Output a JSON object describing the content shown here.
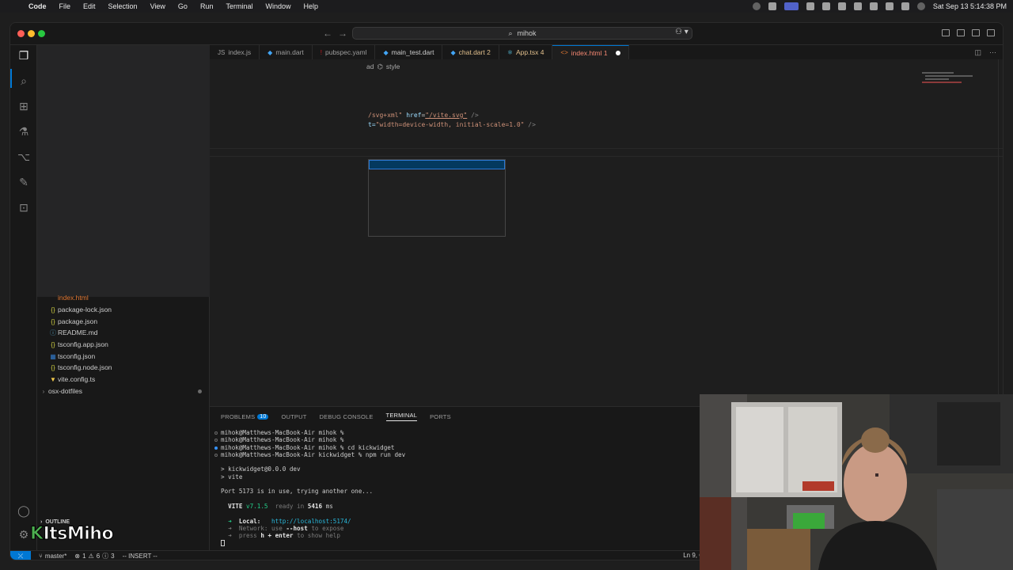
{
  "menubar": {
    "app": "Code",
    "items": [
      "File",
      "Edit",
      "Selection",
      "View",
      "Go",
      "Run",
      "Terminal",
      "Window",
      "Help"
    ],
    "clock": "Sat Sep 13  5:14:38 PM"
  },
  "titlebar": {
    "search": "mihok"
  },
  "tabs": [
    {
      "label": "index.js",
      "icon": "js-icon"
    },
    {
      "label": "main.dart",
      "icon": "dart-icon"
    },
    {
      "label": "pubspec.yaml",
      "icon": "yaml-icon"
    },
    {
      "label": "main_test.dart",
      "icon": "dart-icon"
    },
    {
      "label": "chat.dart 2",
      "icon": "dart-icon"
    },
    {
      "label": "App.tsx 4",
      "icon": "react-icon"
    },
    {
      "label": "index.html 1",
      "icon": "html-icon"
    }
  ],
  "editor": {
    "breadcrumb": [
      "ad",
      "style"
    ],
    "line1_attr1": "/svg+xml\"",
    "line1_href": "href",
    "line1_val": "\"/vite.svg\"",
    "line1_end": " />",
    "line2_prefix": "t=",
    "line2_val": "\"width=device-width, initial-scale=1.0\"",
    "line2_end": " />"
  },
  "files": [
    {
      "name": "index.html",
      "type": "html"
    },
    {
      "name": "package-lock.json",
      "type": "json"
    },
    {
      "name": "package.json",
      "type": "json"
    },
    {
      "name": "README.md",
      "type": "info"
    },
    {
      "name": "tsconfig.app.json",
      "type": "json"
    },
    {
      "name": "tsconfig.json",
      "type": "ts"
    },
    {
      "name": "tsconfig.node.json",
      "type": "json"
    },
    {
      "name": "vite.config.ts",
      "type": "vite"
    },
    {
      "name": "osx-dotfiles",
      "type": "folder"
    }
  ],
  "outline_label": "OUTLINE",
  "watermark": {
    "k": "K",
    "text": "ItsMiho"
  },
  "panel": {
    "tabs": [
      "PROBLEMS",
      "OUTPUT",
      "DEBUG CONSOLE",
      "TERMINAL",
      "PORTS"
    ],
    "problems_count": "10",
    "terminal": {
      "l1": "mihok@Matthews-MacBook-Air mihok %",
      "l2": "mihok@Matthews-MacBook-Air mihok %",
      "l3": "mihok@Matthews-MacBook-Air mihok % cd kickwidget",
      "l4": "mihok@Matthews-MacBook-Air kickwidget % npm run dev",
      "l5": "> kickwidget@0.0.0 dev",
      "l6": "> vite",
      "l7": "Port 5173 is in use, trying another one...",
      "vite_label": "VITE",
      "vite_version": "v7.1.5",
      "ready_text": "ready in",
      "ready_ms": "5416",
      "ms": "ms",
      "local_label": "Local:",
      "local_url": "http://localhost:5174/",
      "network_label": "Network:",
      "network_text": "use",
      "network_flag": "--host",
      "network_tail": "to expose",
      "help_prefix": "press",
      "help_key": "h + enter",
      "help_tail": "to show help"
    }
  },
  "statusbar": {
    "branch": "master*",
    "errors": "1",
    "warnings": "6",
    "info": "3",
    "mode": "-- INSERT --",
    "position": "Ln 9, C"
  }
}
